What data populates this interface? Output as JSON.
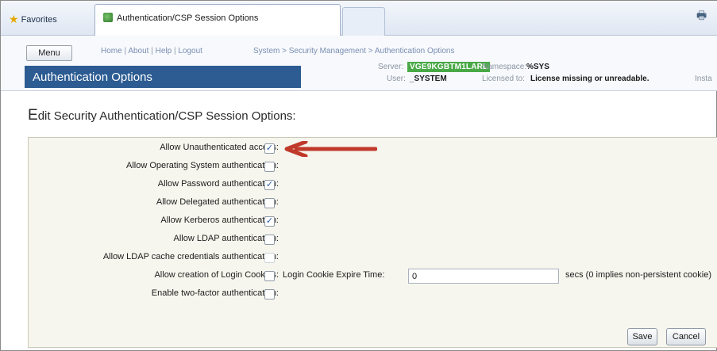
{
  "browser": {
    "favorites_label": "Favorites",
    "tab_title": "Authentication/CSP Session Options"
  },
  "header": {
    "menu_label": "Menu",
    "links": [
      "Home",
      "About",
      "Help",
      "Logout"
    ],
    "breadcrumb": "System > Security Management > Authentication Options",
    "page_title": "Authentication Options",
    "server_label": "Server:",
    "server_value": "VGE9KGBTM1LARL",
    "user_label": "User:",
    "user_value": "_SYSTEM",
    "namespace_label": "Namespace:",
    "namespace_value": "%SYS",
    "licensed_label": "Licensed to:",
    "licensed_value": "License missing or unreadable.",
    "instance_label": "Insta"
  },
  "main": {
    "heading_first": "E",
    "heading_rest": "dit Security Authentication/CSP Session Options:",
    "options": [
      {
        "label": "Allow Unauthenticated access:",
        "checked": true
      },
      {
        "label": "Allow Operating System authentication:",
        "checked": false
      },
      {
        "label": "Allow Password authentication:",
        "checked": true
      },
      {
        "label": "Allow Delegated authentication:",
        "checked": false
      },
      {
        "label": "Allow Kerberos authentication:",
        "checked": true
      },
      {
        "label": "Allow LDAP authentication:",
        "checked": false
      },
      {
        "label": "Allow LDAP cache credentials authentication:",
        "checked": false
      },
      {
        "label": "Allow creation of Login Cookies:",
        "checked": false
      },
      {
        "label": "Enable two-factor authentication:",
        "checked": false
      }
    ],
    "cookie_label": "Login Cookie Expire Time:",
    "cookie_value": "0",
    "cookie_hint": "secs (0 implies non-persistent cookie)",
    "save_label": "Save",
    "cancel_label": "Cancel"
  },
  "colors": {
    "title_banner": "#2c5c92",
    "server_badge": "#4aa947",
    "annotation_arrow": "#c0392b",
    "form_background": "#f6f6ee"
  }
}
